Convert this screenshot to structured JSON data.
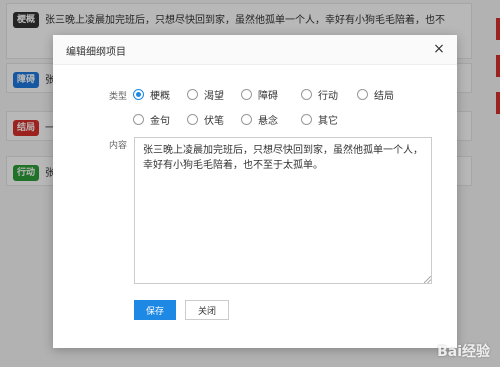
{
  "background_list": [
    {
      "tag": "梗概",
      "tag_color": "#333333",
      "text": "张三晚上凌晨加完班后，只想尽快回到家，虽然他孤单一个人，幸好有小狗毛毛陪着，也不"
    },
    {
      "tag": "障碍",
      "tag_color": "#1e7be0",
      "text": "张"
    },
    {
      "tag": "结局",
      "tag_color": "#d9302b",
      "text": "一"
    },
    {
      "tag": "行动",
      "tag_color": "#2e9e3a",
      "text": "张"
    }
  ],
  "modal": {
    "title": "编辑细纲项目",
    "close_symbol": "×",
    "type_label": "类型",
    "content_label": "内容",
    "types": [
      {
        "label": "梗概",
        "checked": true
      },
      {
        "label": "渴望",
        "checked": false
      },
      {
        "label": "障碍",
        "checked": false
      },
      {
        "label": "行动",
        "checked": false
      },
      {
        "label": "结局",
        "checked": false
      },
      {
        "label": "金句",
        "checked": false
      },
      {
        "label": "伏笔",
        "checked": false
      },
      {
        "label": "悬念",
        "checked": false
      },
      {
        "label": "其它",
        "checked": false
      }
    ],
    "content_value": "张三晚上凌晨加完班后，只想尽快回到家，虽然他孤单一个人，幸好有小狗毛毛陪着，也不至于太孤单。",
    "save_label": "保存",
    "close_label": "关闭"
  },
  "watermark": "Bai经验"
}
